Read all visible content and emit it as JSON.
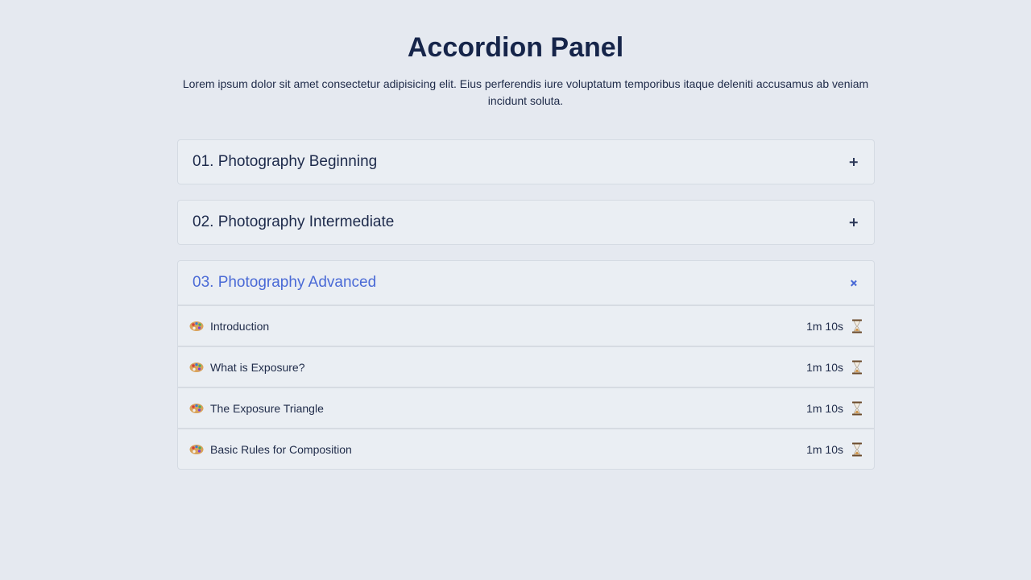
{
  "header": {
    "title": "Accordion Panel",
    "description": "Lorem ipsum dolor sit amet consectetur adipisicing elit. Eius perferendis iure voluptatum temporibus itaque deleniti accusamus ab veniam incidunt soluta."
  },
  "accordion": {
    "accent_color": "#4a6ad6",
    "panels": [
      {
        "title": "01. Photography Beginning",
        "expanded": false,
        "toggle_icon": "plus-icon"
      },
      {
        "title": "02. Photography Intermediate",
        "expanded": false,
        "toggle_icon": "plus-icon"
      },
      {
        "title": "03. Photography Advanced",
        "expanded": true,
        "toggle_icon": "close-icon",
        "lessons": [
          {
            "icon": "palette-icon",
            "label": "Introduction",
            "duration": "1m 10s",
            "duration_icon": "hourglass-icon"
          },
          {
            "icon": "palette-icon",
            "label": "What is Exposure?",
            "duration": "1m 10s",
            "duration_icon": "hourglass-icon"
          },
          {
            "icon": "palette-icon",
            "label": "The Exposure Triangle",
            "duration": "1m 10s",
            "duration_icon": "hourglass-icon"
          },
          {
            "icon": "palette-icon",
            "label": "Basic Rules for Composition",
            "duration": "1m 10s",
            "duration_icon": "hourglass-icon"
          }
        ]
      }
    ]
  }
}
